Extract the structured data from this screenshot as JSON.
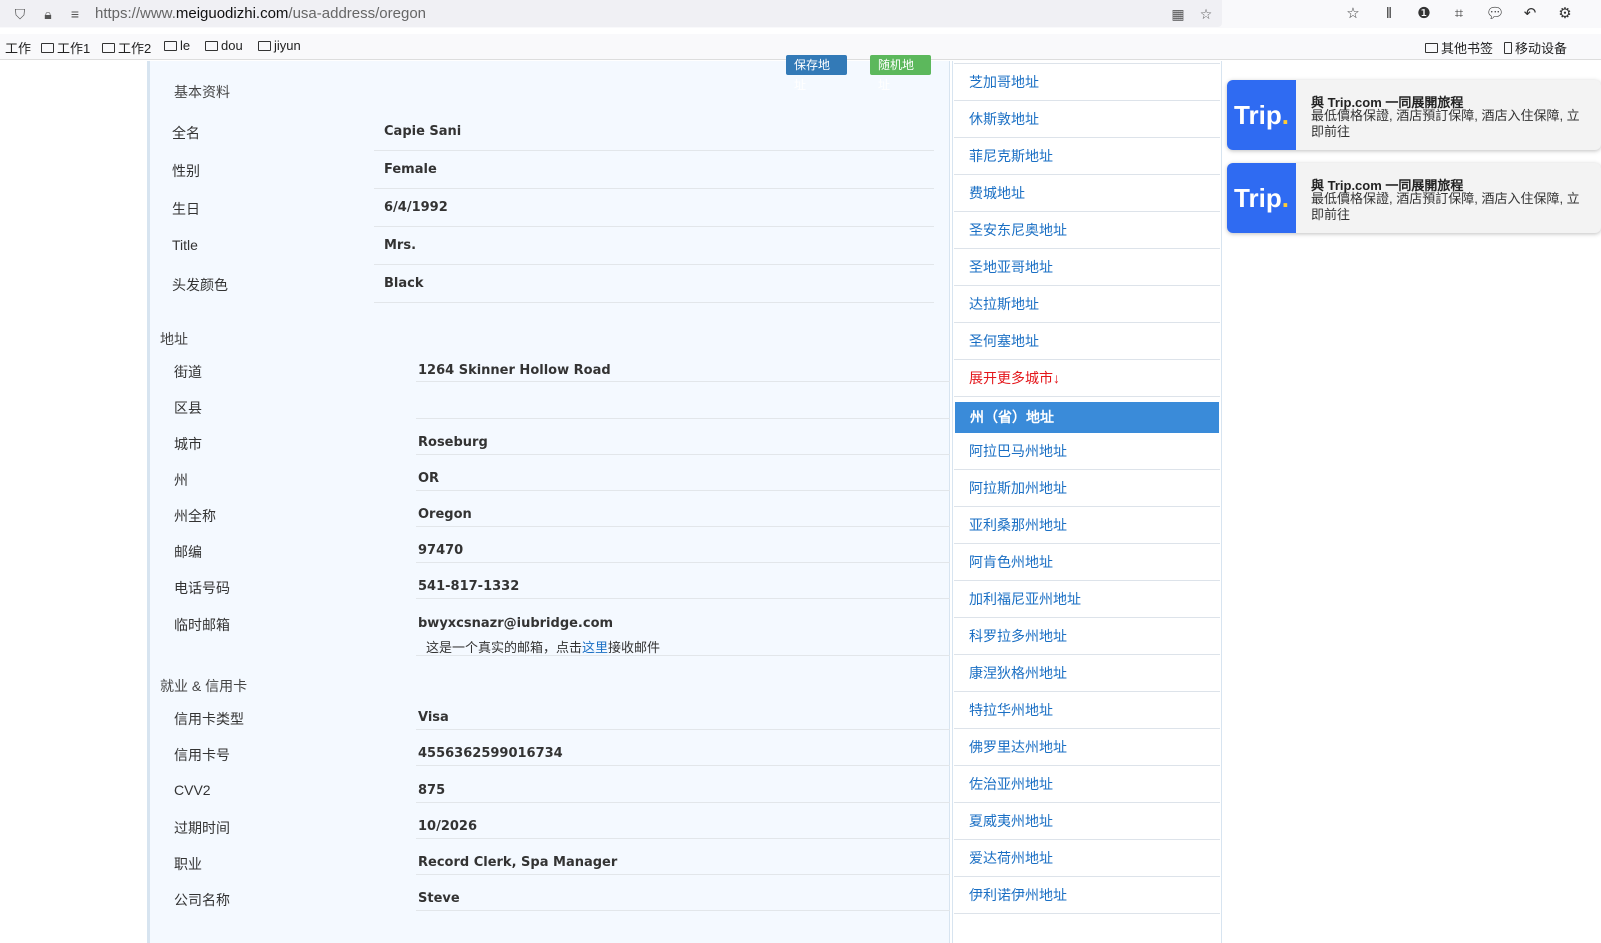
{
  "browser": {
    "url_prefix": "https://www.",
    "url_domain": "meiguodizhi.com",
    "url_path": "/usa-address/oregon",
    "bookmarks": [
      "工作",
      "工作1",
      "工作2",
      "le",
      "dou",
      "jiyun"
    ],
    "bookmarks_right": [
      "其他书签",
      "移动设备"
    ]
  },
  "buttons": {
    "save": "保存地址",
    "random": "随机地址"
  },
  "basic": {
    "title": "基本资料",
    "rows": [
      {
        "label": "全名",
        "value": "Capie Sani"
      },
      {
        "label": "性别",
        "value": "Female"
      },
      {
        "label": "生日",
        "value": "6/4/1992"
      },
      {
        "label": "Title",
        "value": "Mrs."
      },
      {
        "label": "头发颜色",
        "value": "Black"
      }
    ]
  },
  "address": {
    "title": "地址",
    "rows": [
      {
        "label": "街道",
        "value": "1264  Skinner Hollow Road"
      },
      {
        "label": "区县",
        "value": ""
      },
      {
        "label": "城市",
        "value": "Roseburg"
      },
      {
        "label": "州",
        "value": "OR"
      },
      {
        "label": "州全称",
        "value": "Oregon"
      },
      {
        "label": "邮编",
        "value": "97470"
      },
      {
        "label": "电话号码",
        "value": "541-817-1332"
      },
      {
        "label": "临时邮箱",
        "value": "bwyxcsnazr@iubridge.com"
      }
    ],
    "email_note_before": "这是一个真实的邮箱，点击",
    "email_note_link": "这里",
    "email_note_after": "接收邮件"
  },
  "employment": {
    "title": "就业 & 信用卡",
    "rows": [
      {
        "label": "信用卡类型",
        "value": "Visa"
      },
      {
        "label": "信用卡号",
        "value": "4556362599016734"
      },
      {
        "label": "CVV2",
        "value": "875"
      },
      {
        "label": "过期时间",
        "value": "10/2026"
      },
      {
        "label": "职业",
        "value": "Record Clerk, Spa Manager"
      },
      {
        "label": "公司名称",
        "value": "Steve"
      }
    ]
  },
  "sidebar": {
    "cities": [
      "芝加哥地址",
      "休斯敦地址",
      "菲尼克斯地址",
      "费城地址",
      "圣安东尼奥地址",
      "圣地亚哥地址",
      "达拉斯地址",
      "圣何塞地址"
    ],
    "more": "展开更多城市↓",
    "states_header": "州（省）地址",
    "states": [
      "阿拉巴马州地址",
      "阿拉斯加州地址",
      "亚利桑那州地址",
      "阿肯色州地址",
      "加利福尼亚州地址",
      "科罗拉多州地址",
      "康涅狄格州地址",
      "特拉华州地址",
      "佛罗里达州地址",
      "佐治亚州地址",
      "夏威夷州地址",
      "爱达荷州地址",
      "伊利诺伊州地址"
    ]
  },
  "ads": [
    {
      "logo": "Trip",
      "title": "與 Trip.com 一同展開旅程",
      "desc": "最低價格保證, 酒店預訂保障, 酒店入住保障, 立即前往"
    },
    {
      "logo": "Trip",
      "title": "與 Trip.com 一同展開旅程",
      "desc": "最低價格保證, 酒店預訂保障, 酒店入住保障, 立即前往"
    }
  ]
}
